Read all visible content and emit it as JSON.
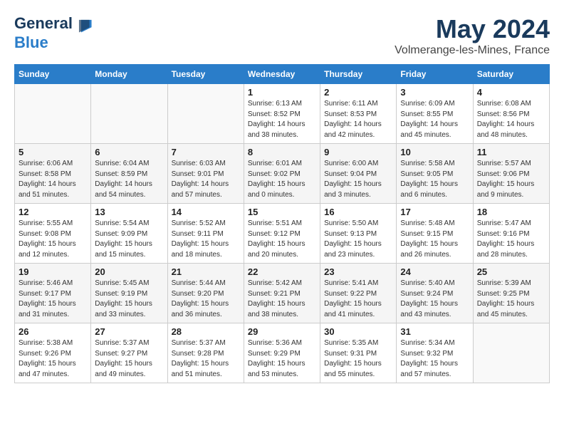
{
  "header": {
    "logo_line1": "General",
    "logo_line2": "Blue",
    "month_title": "May 2024",
    "location": "Volmerange-les-Mines, France"
  },
  "days_of_week": [
    "Sunday",
    "Monday",
    "Tuesday",
    "Wednesday",
    "Thursday",
    "Friday",
    "Saturday"
  ],
  "weeks": [
    [
      {
        "day": "",
        "info": ""
      },
      {
        "day": "",
        "info": ""
      },
      {
        "day": "",
        "info": ""
      },
      {
        "day": "1",
        "info": "Sunrise: 6:13 AM\nSunset: 8:52 PM\nDaylight: 14 hours\nand 38 minutes."
      },
      {
        "day": "2",
        "info": "Sunrise: 6:11 AM\nSunset: 8:53 PM\nDaylight: 14 hours\nand 42 minutes."
      },
      {
        "day": "3",
        "info": "Sunrise: 6:09 AM\nSunset: 8:55 PM\nDaylight: 14 hours\nand 45 minutes."
      },
      {
        "day": "4",
        "info": "Sunrise: 6:08 AM\nSunset: 8:56 PM\nDaylight: 14 hours\nand 48 minutes."
      }
    ],
    [
      {
        "day": "5",
        "info": "Sunrise: 6:06 AM\nSunset: 8:58 PM\nDaylight: 14 hours\nand 51 minutes."
      },
      {
        "day": "6",
        "info": "Sunrise: 6:04 AM\nSunset: 8:59 PM\nDaylight: 14 hours\nand 54 minutes."
      },
      {
        "day": "7",
        "info": "Sunrise: 6:03 AM\nSunset: 9:01 PM\nDaylight: 14 hours\nand 57 minutes."
      },
      {
        "day": "8",
        "info": "Sunrise: 6:01 AM\nSunset: 9:02 PM\nDaylight: 15 hours\nand 0 minutes."
      },
      {
        "day": "9",
        "info": "Sunrise: 6:00 AM\nSunset: 9:04 PM\nDaylight: 15 hours\nand 3 minutes."
      },
      {
        "day": "10",
        "info": "Sunrise: 5:58 AM\nSunset: 9:05 PM\nDaylight: 15 hours\nand 6 minutes."
      },
      {
        "day": "11",
        "info": "Sunrise: 5:57 AM\nSunset: 9:06 PM\nDaylight: 15 hours\nand 9 minutes."
      }
    ],
    [
      {
        "day": "12",
        "info": "Sunrise: 5:55 AM\nSunset: 9:08 PM\nDaylight: 15 hours\nand 12 minutes."
      },
      {
        "day": "13",
        "info": "Sunrise: 5:54 AM\nSunset: 9:09 PM\nDaylight: 15 hours\nand 15 minutes."
      },
      {
        "day": "14",
        "info": "Sunrise: 5:52 AM\nSunset: 9:11 PM\nDaylight: 15 hours\nand 18 minutes."
      },
      {
        "day": "15",
        "info": "Sunrise: 5:51 AM\nSunset: 9:12 PM\nDaylight: 15 hours\nand 20 minutes."
      },
      {
        "day": "16",
        "info": "Sunrise: 5:50 AM\nSunset: 9:13 PM\nDaylight: 15 hours\nand 23 minutes."
      },
      {
        "day": "17",
        "info": "Sunrise: 5:48 AM\nSunset: 9:15 PM\nDaylight: 15 hours\nand 26 minutes."
      },
      {
        "day": "18",
        "info": "Sunrise: 5:47 AM\nSunset: 9:16 PM\nDaylight: 15 hours\nand 28 minutes."
      }
    ],
    [
      {
        "day": "19",
        "info": "Sunrise: 5:46 AM\nSunset: 9:17 PM\nDaylight: 15 hours\nand 31 minutes."
      },
      {
        "day": "20",
        "info": "Sunrise: 5:45 AM\nSunset: 9:19 PM\nDaylight: 15 hours\nand 33 minutes."
      },
      {
        "day": "21",
        "info": "Sunrise: 5:44 AM\nSunset: 9:20 PM\nDaylight: 15 hours\nand 36 minutes."
      },
      {
        "day": "22",
        "info": "Sunrise: 5:42 AM\nSunset: 9:21 PM\nDaylight: 15 hours\nand 38 minutes."
      },
      {
        "day": "23",
        "info": "Sunrise: 5:41 AM\nSunset: 9:22 PM\nDaylight: 15 hours\nand 41 minutes."
      },
      {
        "day": "24",
        "info": "Sunrise: 5:40 AM\nSunset: 9:24 PM\nDaylight: 15 hours\nand 43 minutes."
      },
      {
        "day": "25",
        "info": "Sunrise: 5:39 AM\nSunset: 9:25 PM\nDaylight: 15 hours\nand 45 minutes."
      }
    ],
    [
      {
        "day": "26",
        "info": "Sunrise: 5:38 AM\nSunset: 9:26 PM\nDaylight: 15 hours\nand 47 minutes."
      },
      {
        "day": "27",
        "info": "Sunrise: 5:37 AM\nSunset: 9:27 PM\nDaylight: 15 hours\nand 49 minutes."
      },
      {
        "day": "28",
        "info": "Sunrise: 5:37 AM\nSunset: 9:28 PM\nDaylight: 15 hours\nand 51 minutes."
      },
      {
        "day": "29",
        "info": "Sunrise: 5:36 AM\nSunset: 9:29 PM\nDaylight: 15 hours\nand 53 minutes."
      },
      {
        "day": "30",
        "info": "Sunrise: 5:35 AM\nSunset: 9:31 PM\nDaylight: 15 hours\nand 55 minutes."
      },
      {
        "day": "31",
        "info": "Sunrise: 5:34 AM\nSunset: 9:32 PM\nDaylight: 15 hours\nand 57 minutes."
      },
      {
        "day": "",
        "info": ""
      }
    ]
  ]
}
